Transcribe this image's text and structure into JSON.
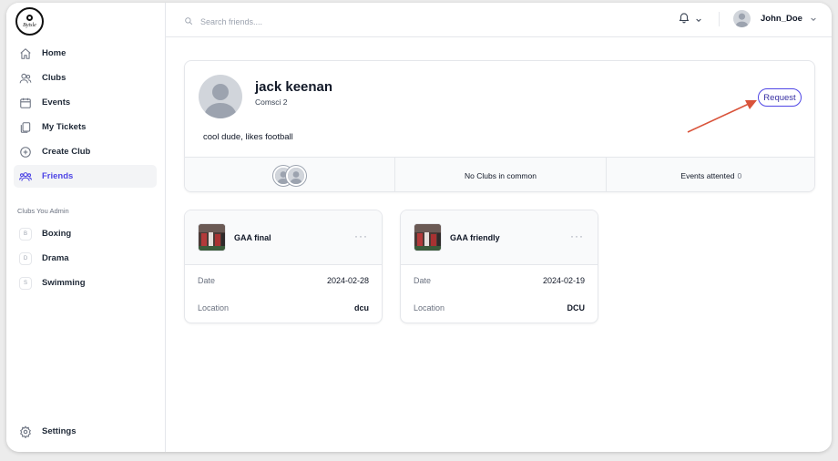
{
  "logo": {
    "text": "Bytsle"
  },
  "sidebar": {
    "items": [
      {
        "label": "Home",
        "icon": "home-icon"
      },
      {
        "label": "Clubs",
        "icon": "users-icon"
      },
      {
        "label": "Events",
        "icon": "calendar-icon"
      },
      {
        "label": "My Tickets",
        "icon": "ticket-icon"
      },
      {
        "label": "Create Club",
        "icon": "plus-circle-icon"
      },
      {
        "label": "Friends",
        "icon": "friends-icon"
      }
    ],
    "active": "Friends",
    "section_label": "Clubs You Admin",
    "admin_clubs": [
      {
        "initial": "B",
        "label": "Boxing"
      },
      {
        "initial": "D",
        "label": "Drama"
      },
      {
        "initial": "S",
        "label": "Swimming"
      }
    ],
    "settings_label": "Settings"
  },
  "topbar": {
    "search_placeholder": "Search friends....",
    "username": "John_Doe"
  },
  "profile": {
    "name": "jack keenan",
    "course": "Comsci 2",
    "bio": "cool dude, likes football",
    "request_label": "Request",
    "clubs_in_common": "No Clubs in common",
    "events_label": "Events attented",
    "events_count": "0"
  },
  "events": [
    {
      "name": "GAA final",
      "date_label": "Date",
      "date": "2024-02-28",
      "location_label": "Location",
      "location": "dcu"
    },
    {
      "name": "GAA friendly",
      "date_label": "Date",
      "date": "2024-02-19",
      "location_label": "Location",
      "location": "DCU"
    }
  ],
  "colors": {
    "accent": "#4f46e5",
    "annotation_arrow": "#d9533a"
  }
}
